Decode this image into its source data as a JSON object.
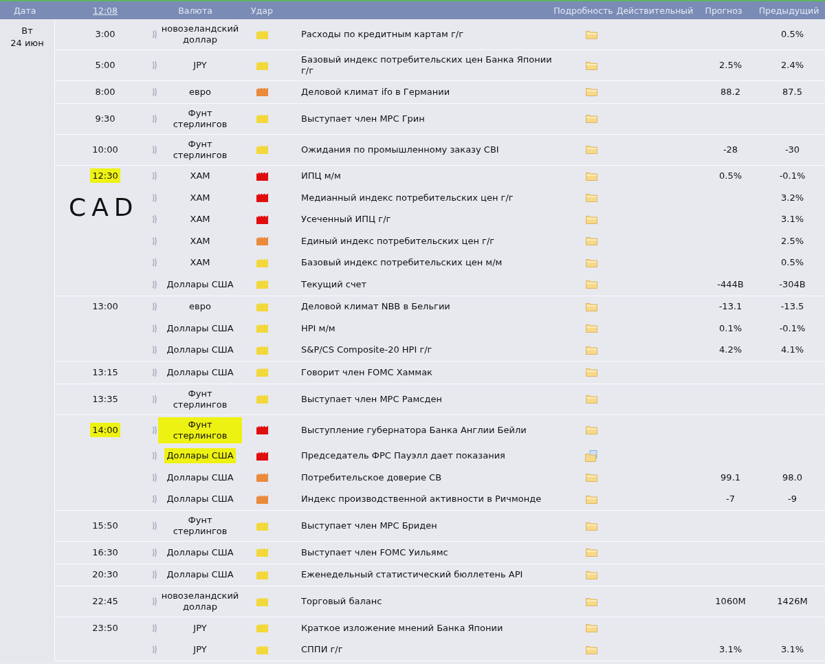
{
  "header": {
    "date": "Дата",
    "clock": "12:08",
    "currency": "Валюта",
    "impact": "Удар",
    "detail": "Подробность",
    "actual": "Действительный",
    "forecast": "Прогноз",
    "previous": "Предыдущий"
  },
  "annotation": {
    "text": "CAD"
  },
  "days": [
    {
      "weekday": "Вт",
      "date": "24 июн",
      "groups": [
        {
          "time": "3:00",
          "highlighted": false,
          "events": [
            {
              "currency": "новозеландский доллар",
              "highlighted": false,
              "color": "#f2d83a",
              "event": "Расходы по кредитным картам г/г",
              "kind": "folder",
              "previous": "0.5%"
            }
          ]
        },
        {
          "time": "5:00",
          "highlighted": false,
          "events": [
            {
              "currency": "JPY",
              "highlighted": false,
              "color": "#f2d83a",
              "event": "Базовый индекс потребительских цен Банка Японии г/г",
              "kind": "folder",
              "forecast": "2.5%",
              "previous": "2.4%"
            }
          ]
        },
        {
          "time": "8:00",
          "highlighted": false,
          "events": [
            {
              "currency": "евро",
              "highlighted": false,
              "color": "#ea8a3c",
              "event": "Деловой климат ifo в Германии",
              "kind": "folder",
              "forecast": "88.2",
              "previous": "87.5"
            }
          ]
        },
        {
          "time": "9:30",
          "highlighted": false,
          "events": [
            {
              "currency": "Фунт стерлингов",
              "highlighted": false,
              "color": "#f2d83a",
              "event": "Выступает член MPC Грин",
              "kind": "folder"
            }
          ]
        },
        {
          "time": "10:00",
          "highlighted": false,
          "events": [
            {
              "currency": "Фунт стерлингов",
              "highlighted": false,
              "color": "#f2d83a",
              "event": "Ожидания по промышленному заказу CBI",
              "kind": "folder",
              "forecast": "-28",
              "previous": "-30"
            }
          ]
        },
        {
          "time": "12:30",
          "highlighted": true,
          "events": [
            {
              "currency": "XAM",
              "highlighted": false,
              "color": "#e00d0d",
              "event": "ИПЦ м/м",
              "kind": "folder",
              "forecast": "0.5%",
              "previous": "-0.1%"
            },
            {
              "currency": "XAM",
              "highlighted": false,
              "color": "#e00d0d",
              "event": "Медианный индекс потребительских цен г/г",
              "kind": "folder",
              "previous": "3.2%"
            },
            {
              "currency": "XAM",
              "highlighted": false,
              "color": "#e00d0d",
              "event": "Усеченный ИПЦ г/г",
              "kind": "folder",
              "previous": "3.1%"
            },
            {
              "currency": "XAM",
              "highlighted": false,
              "color": "#ea8a3c",
              "event": "Единый индекс потребительских цен г/г",
              "kind": "folder",
              "previous": "2.5%"
            },
            {
              "currency": "XAM",
              "highlighted": false,
              "color": "#f2d83a",
              "event": "Базовый индекс потребительских цен м/м",
              "kind": "folder",
              "previous": "0.5%"
            },
            {
              "currency": "Доллары США",
              "highlighted": false,
              "color": "#f2d83a",
              "event": "Текущий счет",
              "kind": "folder",
              "forecast": "-444B",
              "previous": "-304B"
            }
          ]
        },
        {
          "time": "13:00",
          "highlighted": false,
          "events": [
            {
              "currency": "евро",
              "highlighted": false,
              "color": "#f2d83a",
              "event": "Деловой климат NBB в Бельгии",
              "kind": "folder",
              "forecast": "-13.1",
              "previous": "-13.5"
            },
            {
              "currency": "Доллары США",
              "highlighted": false,
              "color": "#f2d83a",
              "event": "HPI м/м",
              "kind": "folder",
              "forecast": "0.1%",
              "previous": "-0.1%"
            },
            {
              "currency": "Доллары США",
              "highlighted": false,
              "color": "#f2d83a",
              "event": "S&P/CS Composite-20 HPI г/г",
              "kind": "folder",
              "forecast": "4.2%",
              "previous": "4.1%"
            }
          ]
        },
        {
          "time": "13:15",
          "highlighted": false,
          "events": [
            {
              "currency": "Доллары США",
              "highlighted": false,
              "color": "#f2d83a",
              "event": "Говорит член FOMC Хаммак",
              "kind": "folder"
            }
          ]
        },
        {
          "time": "13:35",
          "highlighted": false,
          "events": [
            {
              "currency": "Фунт стерлингов",
              "highlighted": false,
              "color": "#f2d83a",
              "event": "Выступает член MPC Рамсден",
              "kind": "folder"
            }
          ]
        },
        {
          "time": "14:00",
          "highlighted": true,
          "events": [
            {
              "currency": "Фунт стерлингов",
              "highlighted": true,
              "color": "#e00d0d",
              "event": "Выступление губернатора Банка Англии Бейли",
              "kind": "folder"
            },
            {
              "currency": "Доллары США",
              "highlighted": true,
              "color": "#e00d0d",
              "event": "Председатель ФРС Пауэлл дает показания",
              "kind": "folder-doc"
            },
            {
              "currency": "Доллары США",
              "highlighted": false,
              "color": "#ea8a3c",
              "event": "Потребительское доверие CB",
              "kind": "folder",
              "forecast": "99.1",
              "previous": "98.0"
            },
            {
              "currency": "Доллары США",
              "highlighted": false,
              "color": "#ea8a3c",
              "event": "Индекс производственной активности в Ричмонде",
              "kind": "folder",
              "forecast": "-7",
              "previous": "-9"
            }
          ]
        },
        {
          "time": "15:50",
          "highlighted": false,
          "events": [
            {
              "currency": "Фунт стерлингов",
              "highlighted": false,
              "color": "#f2d83a",
              "event": "Выступает член MPC Бриден",
              "kind": "folder"
            }
          ]
        },
        {
          "time": "16:30",
          "highlighted": false,
          "events": [
            {
              "currency": "Доллары США",
              "highlighted": false,
              "color": "#f2d83a",
              "event": "Выступает член FOMC Уильямс",
              "kind": "folder"
            }
          ]
        },
        {
          "time": "20:30",
          "highlighted": false,
          "events": [
            {
              "currency": "Доллары США",
              "highlighted": false,
              "color": "#f2d83a",
              "event": "Еженедельный статистический бюллетень API",
              "kind": "folder"
            }
          ]
        },
        {
          "time": "22:45",
          "highlighted": false,
          "events": [
            {
              "currency": "новозеландский доллар",
              "highlighted": false,
              "color": "#f2d83a",
              "event": "Торговый баланс",
              "kind": "folder",
              "forecast": "1060M",
              "previous": "1426M"
            }
          ]
        },
        {
          "time": "23:50",
          "highlighted": false,
          "events": [
            {
              "currency": "JPY",
              "highlighted": false,
              "color": "#f2d83a",
              "event": "Краткое изложение мнений Банка Японии",
              "kind": "folder"
            },
            {
              "currency": "JPY",
              "highlighted": false,
              "color": "#f2d83a",
              "event": "СППИ г/г",
              "kind": "folder",
              "forecast": "3.1%",
              "previous": "3.1%"
            }
          ]
        }
      ]
    }
  ]
}
